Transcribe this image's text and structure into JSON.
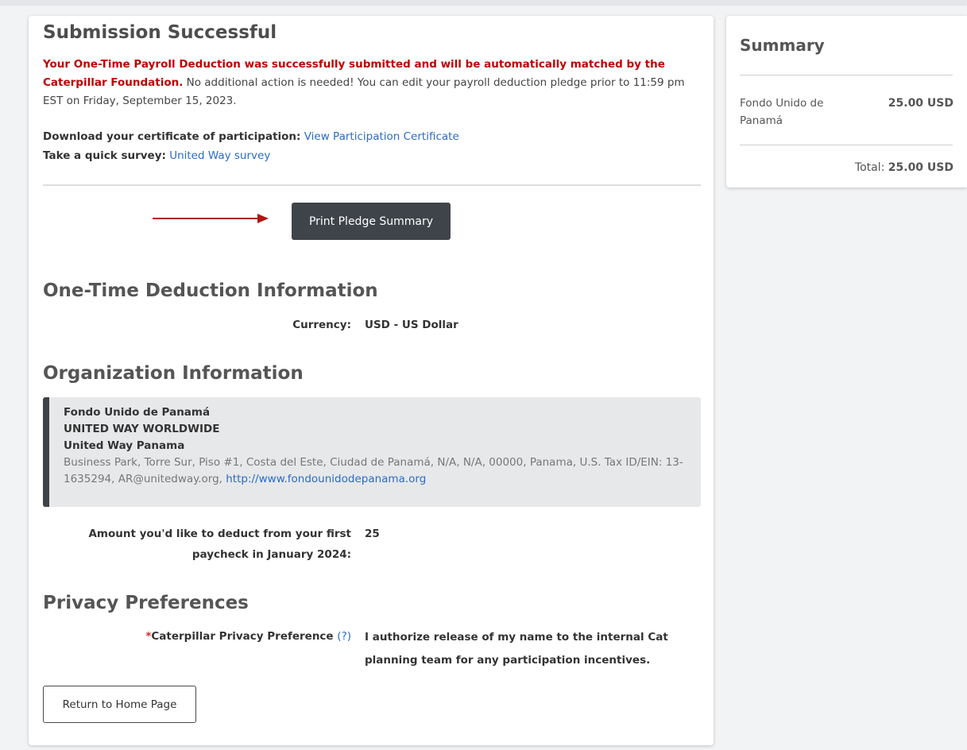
{
  "success": {
    "title": "Submission Successful",
    "message_red": "Your One-Time Payroll Deduction was successfully submitted and will be automatically matched by the Caterpillar Foundation.",
    "message_rest": " No additional action is needed! You can edit your payroll deduction pledge prior to 11:59 pm EST on Friday, September 15, 2023.",
    "certificate_label": "Download your certificate of participation:",
    "certificate_link": "View Participation Certificate",
    "survey_label": "Take a quick survey:",
    "survey_link": "United Way survey",
    "print_button": "Print Pledge Summary"
  },
  "deduction": {
    "title": "One-Time Deduction Information",
    "currency_label": "Currency:",
    "currency_value": "USD - US Dollar"
  },
  "organization": {
    "title": "Organization Information",
    "name": "Fondo Unido de Panamá",
    "line2": "UNITED WAY WORLDWIDE",
    "line3": "United Way Panama",
    "address": "Business Park, Torre Sur, Piso #1, Costa del Este, Ciudad de Panamá, N/A, N/A, 00000, Panama, U.S. Tax ID/EIN: 13-1635294, AR@unitedway.org, ",
    "website": "http://www.fondounidodepanama.org",
    "amount_label_1": "Amount you'd like to deduct from your first",
    "amount_label_2": "paycheck in January 2024:",
    "amount_value": "25"
  },
  "privacy": {
    "title": "Privacy Preferences",
    "required_mark": "*",
    "label": "Caterpillar Privacy Preference",
    "help": "(?)",
    "value_1": "I authorize release of my name to the internal Cat",
    "value_2": "planning team for any participation incentives."
  },
  "home_button": "Return to Home Page",
  "summary": {
    "title": "Summary",
    "org_name": "Fondo Unido de Panamá",
    "org_amount": "25.00 USD",
    "total_label": "Total:",
    "total_amount": "25.00 USD"
  },
  "colors": {
    "accent_red": "#c00000",
    "link_blue": "#2b6cc4",
    "dark_button": "#3f444a",
    "arrow": "#b01616"
  },
  "icons": {
    "arrow": "right-arrow-icon"
  }
}
